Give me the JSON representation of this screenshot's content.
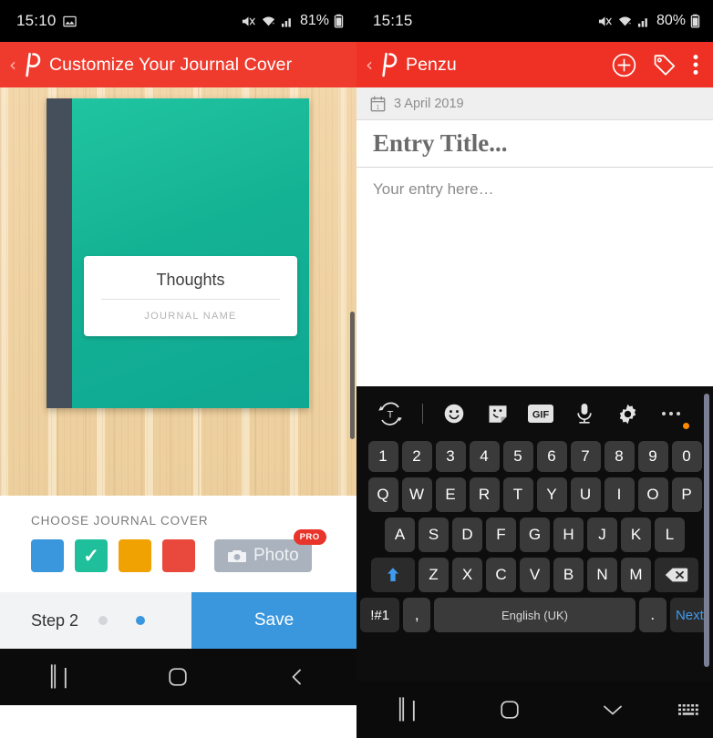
{
  "left_phone": {
    "status_bar": {
      "time": "15:10",
      "battery_pct": "81%",
      "icons": [
        "image-icon",
        "mute-icon",
        "wifi-icon",
        "signal-icon",
        "battery-icon"
      ]
    },
    "app_bar": {
      "back_icon": "back-chevron-icon",
      "logo_icon": "penzu-p-logo-icon",
      "title": "Customize Your Journal Cover",
      "background_color": "#ef3b2d"
    },
    "preview": {
      "background": "wood-texture",
      "book": {
        "spine_color": "#454f5b",
        "cover_color": "#14b294",
        "label_title": "Thoughts",
        "label_subtitle": "JOURNAL NAME"
      }
    },
    "chooser": {
      "label": "CHOOSE JOURNAL COVER",
      "swatches": [
        {
          "name": "blue",
          "color": "#3a97de",
          "selected": false
        },
        {
          "name": "teal",
          "color": "#1fbf9c",
          "selected": true,
          "check": "✓"
        },
        {
          "name": "orange",
          "color": "#f0a202",
          "selected": false
        },
        {
          "name": "red",
          "color": "#e8493c",
          "selected": false
        }
      ],
      "photo_button": {
        "label": "Photo",
        "icon": "camera-icon",
        "badge": "PRO",
        "badge_color": "#e8342a",
        "background_color": "#a9b2bd"
      }
    },
    "step_bar": {
      "step_text": "Step 2",
      "dots": [
        "inactive",
        "active"
      ],
      "active_dot_color": "#3a97de",
      "save_label": "Save",
      "save_color": "#3a97de"
    },
    "nav_bar": {
      "items": [
        "recents-icon",
        "home-icon",
        "back-icon"
      ]
    }
  },
  "right_phone": {
    "status_bar": {
      "time": "15:15",
      "battery_pct": "80%",
      "icons": [
        "mute-icon",
        "wifi-icon",
        "signal-icon",
        "battery-icon"
      ]
    },
    "app_bar": {
      "back_icon": "back-chevron-icon",
      "logo_icon": "penzu-p-logo-icon",
      "title": "Penzu",
      "actions": [
        "add-entry-icon",
        "tag-icon",
        "overflow-menu-icon"
      ],
      "background_color": "#ee3124"
    },
    "date_bar": {
      "icon": "calendar-icon",
      "date": "3 April 2019"
    },
    "editor": {
      "title_placeholder": "Entry Title...",
      "body_placeholder": "Your entry here…"
    },
    "keyboard": {
      "toolbar": [
        {
          "name": "text-rotate-icon",
          "label": "T"
        },
        {
          "name": "toolbar-divider",
          "label": ""
        },
        {
          "name": "emoji-icon",
          "label": ""
        },
        {
          "name": "sticker-icon",
          "label": ""
        },
        {
          "name": "gif-icon",
          "label": "GIF"
        },
        {
          "name": "microphone-icon",
          "label": ""
        },
        {
          "name": "settings-gear-icon",
          "label": ""
        },
        {
          "name": "more-options-icon",
          "label": ""
        }
      ],
      "rows": {
        "numbers": [
          "1",
          "2",
          "3",
          "4",
          "5",
          "6",
          "7",
          "8",
          "9",
          "0"
        ],
        "top": [
          "Q",
          "W",
          "E",
          "R",
          "T",
          "Y",
          "U",
          "I",
          "O",
          "P"
        ],
        "home": [
          "A",
          "S",
          "D",
          "F",
          "G",
          "H",
          "J",
          "K",
          "L"
        ],
        "bottom": [
          "Z",
          "X",
          "C",
          "V",
          "B",
          "N",
          "M"
        ],
        "shift_icon": "shift-arrow-icon",
        "backspace_icon": "backspace-icon"
      },
      "bottom_row": {
        "symbols_label": "!#1",
        "comma_label": ",",
        "space_label": "English (UK)",
        "period_label": ".",
        "next_label": "Next",
        "next_color": "#3f9bf0"
      }
    },
    "nav_bar": {
      "items": [
        "recents-icon",
        "home-icon",
        "hide-keyboard-icon",
        "keyboard-switch-icon"
      ]
    }
  }
}
